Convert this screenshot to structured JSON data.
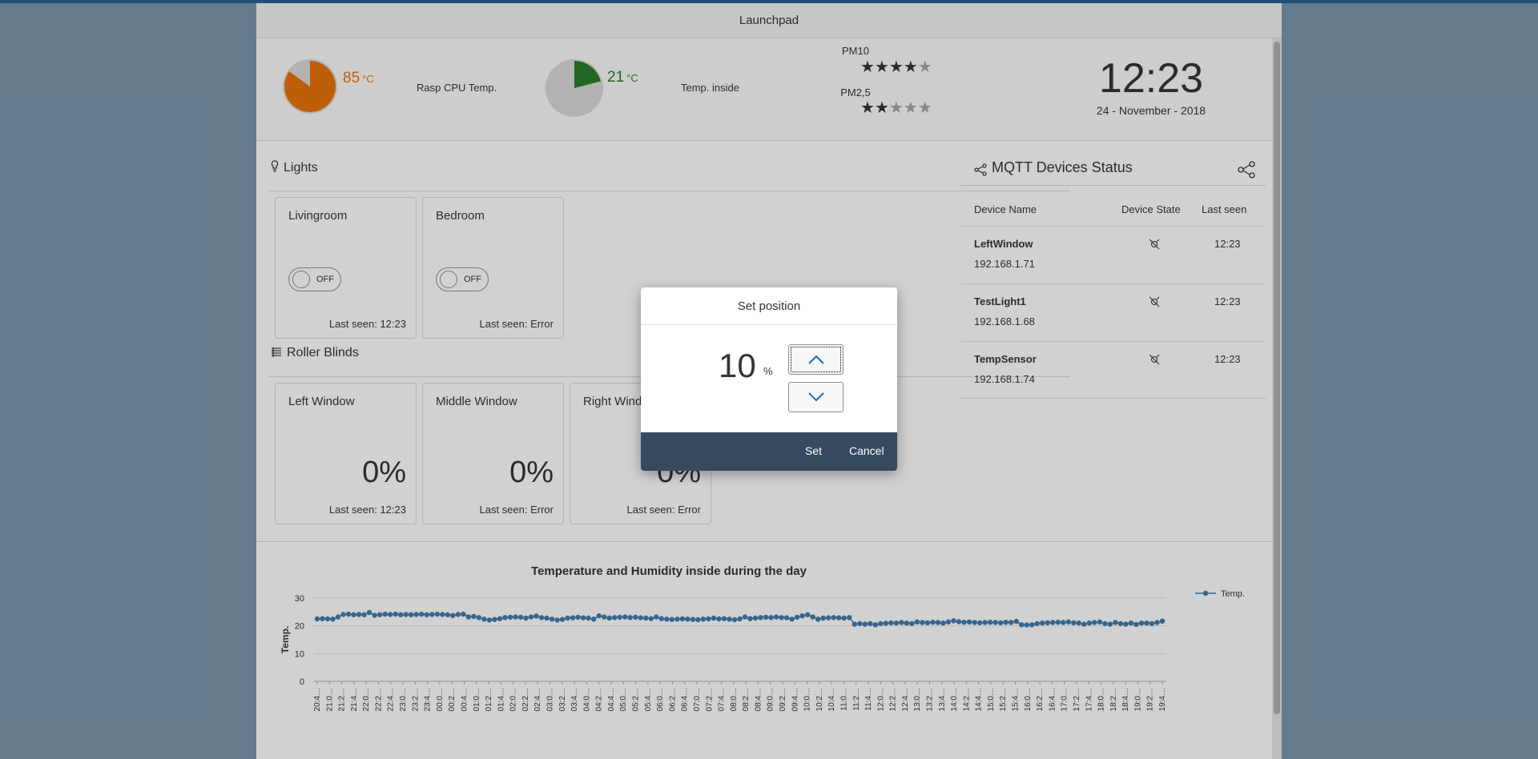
{
  "shell": {
    "title": "Launchpad"
  },
  "kpis": {
    "cpu": {
      "value": "85",
      "unit": "°C",
      "label": "Rasp CPU Temp.",
      "fraction": 0.85,
      "color": "#e9730c"
    },
    "inside": {
      "value": "21",
      "unit": "°C",
      "label": "Temp. inside",
      "fraction": 0.21,
      "color": "#2b7d2b"
    },
    "pm10": {
      "label": "PM10",
      "stars": 4,
      "max": 5
    },
    "pm25": {
      "label": "PM2,5",
      "stars": 2,
      "max": 5
    },
    "clock": {
      "time": "12:23",
      "date": "24 - November - 2018"
    }
  },
  "lights": {
    "title": "Lights",
    "tiles": [
      {
        "title": "Livingroom",
        "state": "OFF",
        "last_seen": "Last seen: 12:23"
      },
      {
        "title": "Bedroom",
        "state": "OFF",
        "last_seen": "Last seen: Error"
      }
    ]
  },
  "blinds": {
    "title": "Roller Blinds",
    "tiles": [
      {
        "title": "Left Window",
        "value": "0%",
        "last_seen": "Last seen: 12:23"
      },
      {
        "title": "Middle Window",
        "value": "0%",
        "last_seen": "Last seen: Error"
      },
      {
        "title": "Right Window",
        "value": "0%",
        "last_seen": "Last seen: Error"
      }
    ]
  },
  "mqtt": {
    "title": "MQTT Devices Status",
    "columns": [
      "Device Name",
      "Device State",
      "Last seen"
    ],
    "rows": [
      {
        "name": "LeftWindow",
        "ip": "192.168.1.71",
        "state_icon": "disconnected-icon",
        "last_seen": "12:23"
      },
      {
        "name": "TestLight1",
        "ip": "192.168.1.68",
        "state_icon": "disconnected-icon",
        "last_seen": "12:23"
      },
      {
        "name": "TempSensor",
        "ip": "192.168.1.74",
        "state_icon": "disconnected-icon",
        "last_seen": "12:23"
      }
    ]
  },
  "chart_data": {
    "type": "line",
    "title": "Temperature and Humidity inside during the day",
    "xlabel": "",
    "ylabel": "Temp.",
    "ylim": [
      0,
      30
    ],
    "yticks": [
      0,
      10,
      20,
      30
    ],
    "grid": true,
    "legend_position": "top-right",
    "series": [
      {
        "name": "Temp.",
        "color": "#427cac",
        "values": [
          22.5,
          22.6,
          22.5,
          22.4,
          23.2,
          24.1,
          24.2,
          24.0,
          24.1,
          24.0,
          24.8,
          23.8,
          24.0,
          24.2,
          24.1,
          24.2,
          24.0,
          24.1,
          24.0,
          24.1,
          24.2,
          24.0,
          24.1,
          24.2,
          24.1,
          24.0,
          23.7,
          24.1,
          24.2,
          23.2,
          23.4,
          23.0,
          22.4,
          22.1,
          22.3,
          22.6,
          23.0,
          23.1,
          23.2,
          23.1,
          22.8,
          23.2,
          23.5,
          23.0,
          22.8,
          22.4,
          22.1,
          22.3,
          22.8,
          22.9,
          23.1,
          22.9,
          22.8,
          22.4,
          23.6,
          23.2,
          22.8,
          23.0,
          23.1,
          23.2,
          23.0,
          23.1,
          22.9,
          22.8,
          22.6,
          23.2,
          22.6,
          22.4,
          22.3,
          22.4,
          22.5,
          22.4,
          22.3,
          22.2,
          22.4,
          22.5,
          22.8,
          22.5,
          22.6,
          22.4,
          22.2,
          22.5,
          23.2,
          22.6,
          22.8,
          23.0,
          23.1,
          23.0,
          23.2,
          23.0,
          22.9,
          22.4,
          23.1,
          23.6,
          24.0,
          23.2,
          22.4,
          22.8,
          22.9,
          23.0,
          22.9,
          22.8,
          23.0,
          20.6,
          20.8,
          20.6,
          20.8,
          20.4,
          20.8,
          20.9,
          21.1,
          21.0,
          21.2,
          21.0,
          20.8,
          21.4,
          21.2,
          21.1,
          21.3,
          21.2,
          21.0,
          21.4,
          21.8,
          21.5,
          21.3,
          21.4,
          21.2,
          21.1,
          21.2,
          21.3,
          21.2,
          21.1,
          21.3,
          21.2,
          21.6,
          20.4,
          20.3,
          20.4,
          20.8,
          21.0,
          21.1,
          21.2,
          21.3,
          21.2,
          21.4,
          21.1,
          21.0,
          20.6,
          21.0,
          21.2,
          21.4,
          20.8,
          20.6,
          21.2,
          20.8,
          20.6,
          21.0,
          20.5,
          21.0,
          21.0,
          20.8,
          21.2,
          21.7
        ]
      }
    ],
    "x": [
      "20:4…",
      "21:0…",
      "21:2…",
      "21:4…",
      "22:0…",
      "22:2…",
      "22:4…",
      "23:0…",
      "23:2…",
      "23:4…",
      "00:0…",
      "00:2…",
      "00:4…",
      "01:0…",
      "01:2…",
      "01:4…",
      "02:0…",
      "02:2…",
      "02:4…",
      "03:0…",
      "03:2…",
      "03:4…",
      "04:0…",
      "04:2…",
      "04:4…",
      "05:0…",
      "05:2…",
      "05:4…",
      "06:0…",
      "06:2…",
      "06:4…",
      "07:0…",
      "07:2…",
      "07:4…",
      "08:0…",
      "08:2…",
      "08:4…",
      "09:0…",
      "09:2…",
      "09:4…",
      "10:0…",
      "10:2…",
      "10:4…",
      "11:0…",
      "11:2…",
      "11:4…",
      "12:0…",
      "12:2…",
      "12:4…",
      "13:0…",
      "13:2…",
      "13:4…",
      "14:0…",
      "14:2…",
      "14:4…",
      "15:0…",
      "15:2…",
      "15:4…",
      "16:0…",
      "16:2…",
      "16:4…",
      "17:0…",
      "17:2…",
      "17:4…",
      "18:0…",
      "18:2…",
      "18:4…",
      "19:0…",
      "19:2…",
      "19:4…"
    ]
  },
  "dialog": {
    "title": "Set position",
    "value": "10",
    "unit": "%",
    "set_label": "Set",
    "cancel_label": "Cancel"
  }
}
